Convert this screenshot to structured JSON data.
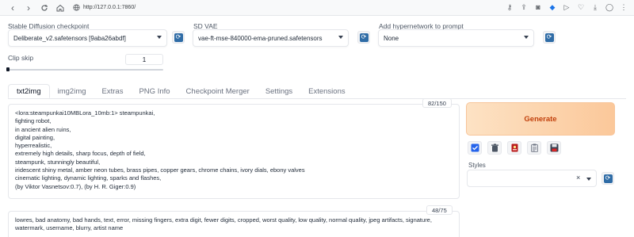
{
  "browser": {
    "url": "http://127.0.0.1:7860/",
    "back_icon": "back-arrow-icon",
    "forward_icon": "forward-arrow-icon",
    "reload_icon": "reload-icon",
    "home_icon": "home-icon",
    "site_icon": "globe-icon",
    "extensions": [
      "key-icon",
      "share-icon",
      "camera-icon",
      "shield-icon",
      "play-icon",
      "heart-icon",
      "download-icon",
      "user-icon",
      "menu-icon"
    ]
  },
  "settings": {
    "checkpoint_label": "Stable Diffusion checkpoint",
    "checkpoint_value": "Deliberate_v2.safetensors [9aba26abdf]",
    "vae_label": "SD VAE",
    "vae_value": "vae-ft-mse-840000-ema-pruned.safetensors",
    "hypernetwork_label": "Add hypernetwork to prompt",
    "hypernetwork_value": "None",
    "clip_skip_label": "Clip skip",
    "clip_skip_value": "1"
  },
  "tabs": [
    "txt2img",
    "img2img",
    "Extras",
    "PNG Info",
    "Checkpoint Merger",
    "Settings",
    "Extensions"
  ],
  "active_tab": "txt2img",
  "prompt": {
    "token_count": "82/150",
    "lines": [
      "<lora:steampunkai10MBLora_10mb:1> steampunkai,",
      "fighting robot,",
      "in ancient alien ruins,",
      "digital painting,",
      "hyperrealistic,",
      "extremely high details, sharp focus, depth of field,",
      "steampunk, stunningly beautiful,",
      "iridescent shiny metal, amber neon tubes, brass pipes, copper gears, chrome chains, ivory dials, ebony valves",
      "cinematic lighting, dynamic lighting, sparks and flashes,",
      "(by Viktor Vasnetsov:0.7), (by H. R. Giger:0.9)"
    ]
  },
  "negative_prompt": {
    "token_count": "48/75",
    "lines": [
      "lowres, bad anatomy, bad hands, text, error, missing fingers, extra digit, fewer digits, cropped, worst quality, low quality, normal quality, jpeg artifacts, signature,",
      "watermark, username, blurry, artist name"
    ]
  },
  "actions": {
    "generate_label": "Generate",
    "tools": [
      "checkbox-icon",
      "trash-icon",
      "red-card-icon",
      "clipboard-icon",
      "save-icon"
    ]
  },
  "styles": {
    "label": "Styles",
    "clear_glyph": "×"
  },
  "colors": {
    "generate_text": "#c2410c",
    "refresh_blue": "#2f6ca6",
    "checkbox_blue": "#2563eb"
  }
}
